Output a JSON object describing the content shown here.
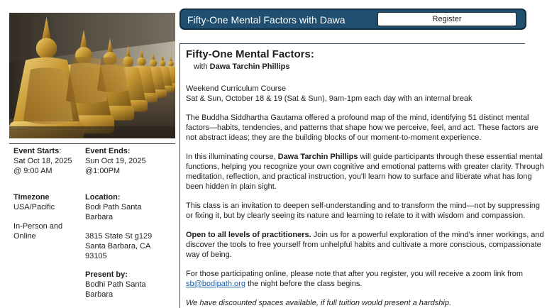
{
  "colors": {
    "header_bg": "#1f4e6e",
    "header_text": "#ffffff",
    "link": "#1f5fa8",
    "rule": "#2a4e66"
  },
  "hero": {
    "icon": "buddha-statues-photo"
  },
  "header": {
    "title": "Fifty-One Mental Factors with Dawa",
    "register_label": "Register"
  },
  "event": {
    "starts_label": "Event Starts",
    "starts_colon": ":",
    "starts_date": "Sat Oct 18, 2025",
    "starts_time": "@ 9:00 AM",
    "ends_label": "Event Ends:",
    "ends_date": "Sun Oct 19, 2025",
    "ends_time": "@1:00PM",
    "timezone_label": "Timezone",
    "timezone_value": "USA/Pacific",
    "format": "In-Person and Online",
    "location_label": "Location:",
    "location_name": "Bodi Path Santa Barbara",
    "address_street": "3815 State St g129",
    "address_city": "Santa Barbara, CA",
    "address_zip": "93105",
    "present_label": "Present by:",
    "present_value": "Bodhi Path Santa Barbara"
  },
  "main": {
    "title": "Fifty-One Mental Factors:",
    "with_prefix": "with ",
    "teacher": "Dawa Tarchin Phillips",
    "course_type": "Weekend Curriculum Course",
    "schedule": "Sat & Sun, October 18 & 19 (Sat & Sun), 9am-1pm each day with an internal break",
    "p1": "The Buddha Siddhartha Gautama offered a profound map of the mind, identifying 51 distinct mental factors—habits, tendencies, and patterns that shape how we perceive, feel, and act. These factors are not abstract ideas; they are the building blocks of our moment-to-moment experience.",
    "p2_before": "In this illuminating course, ",
    "p2_name": "Dawa Tarchin Phillips",
    "p2_after": " will guide participants through these essential mental functions, helping you recognize your own cognitive and emotional patterns with greater clarity. Through meditation, reflection, and practical instruction, you'll learn how to surface and liberate what has long been hidden in plain sight.",
    "p3": "This class is an invitation to deepen self-understanding and to transform the mind—not by suppressing or fixing it, but by clearly seeing its nature and learning to relate to it with wisdom and compassion.",
    "p4_bold": "Open to all levels of practitioners.",
    "p4_rest": " Join us for a powerful exploration of the mind's inner workings, and discover the tools to free yourself from unhelpful habits and cultivate a more conscious, compassionate way of being.",
    "p5_before": "For those participating online, please note that after you register, you will receive a zoom link from ",
    "p5_email": "sb@bodipath.org",
    "p5_after": " the night before the class begins.",
    "p6": "We have discounted spaces available, if full tuition would present a hardship."
  }
}
